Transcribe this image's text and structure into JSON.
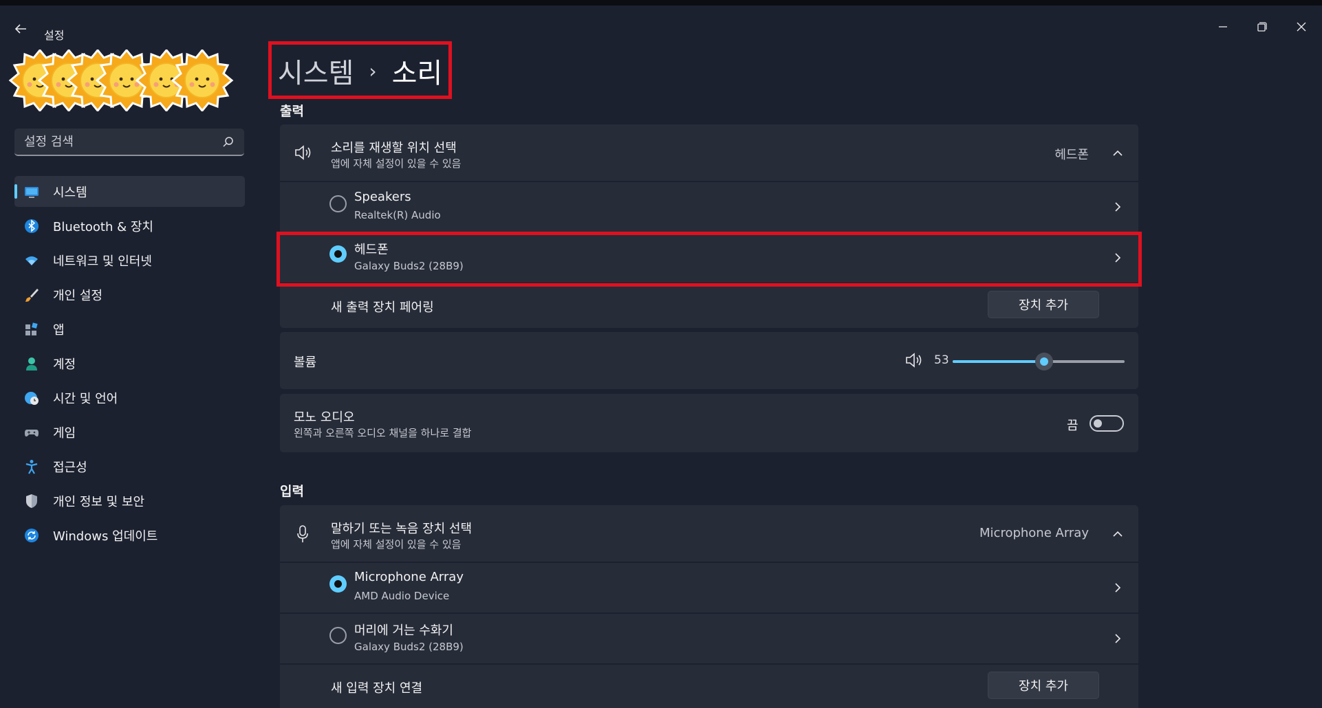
{
  "window": {
    "title": "설정"
  },
  "search": {
    "placeholder": "설정 검색"
  },
  "sidebar": {
    "items": [
      {
        "label": "시스템",
        "icon": "monitor-icon"
      },
      {
        "label": "Bluetooth & 장치",
        "icon": "bluetooth-icon"
      },
      {
        "label": "네트워크 및 인터넷",
        "icon": "wifi-icon"
      },
      {
        "label": "개인 설정",
        "icon": "brush-icon"
      },
      {
        "label": "앱",
        "icon": "apps-icon"
      },
      {
        "label": "계정",
        "icon": "person-icon"
      },
      {
        "label": "시간 및 언어",
        "icon": "globe-clock-icon"
      },
      {
        "label": "게임",
        "icon": "gamepad-icon"
      },
      {
        "label": "접근성",
        "icon": "accessibility-icon"
      },
      {
        "label": "개인 정보 및 보안",
        "icon": "shield-icon"
      },
      {
        "label": "Windows 업데이트",
        "icon": "update-icon"
      }
    ],
    "active_index": 0
  },
  "breadcrumb": {
    "parent": "시스템",
    "separator": "›",
    "current": "소리"
  },
  "output": {
    "heading": "출력",
    "select": {
      "title": "소리를 재생할 위치 선택",
      "subtitle": "앱에 자체 설정이 있을 수 있음",
      "value": "헤드폰"
    },
    "devices": [
      {
        "name": "Speakers",
        "detail": "Realtek(R) Audio",
        "selected": false
      },
      {
        "name": "헤드폰",
        "detail": "Galaxy Buds2 (28B9)",
        "selected": true
      }
    ],
    "pair": {
      "label": "새 출력 장치 페어링",
      "button": "장치 추가"
    }
  },
  "volume": {
    "label": "볼륨",
    "value": "53",
    "level": 0.53
  },
  "mono": {
    "title": "모노 오디오",
    "subtitle": "왼쪽과 오른쪽 오디오 채널을 하나로 결합",
    "state": "끔"
  },
  "input": {
    "heading": "입력",
    "select": {
      "title": "말하기 또는 녹음 장치 선택",
      "subtitle": "앱에 자체 설정이 있을 수 있음",
      "value": "Microphone Array"
    },
    "devices": [
      {
        "name": "Microphone Array",
        "detail": "AMD Audio Device",
        "selected": true
      },
      {
        "name": "머리에 거는 수화기",
        "detail": "Galaxy Buds2 (28B9)",
        "selected": false
      }
    ],
    "connect": {
      "label": "새 입력 장치 연결",
      "button": "장치 추가"
    }
  },
  "colors": {
    "accent": "#60cdff",
    "highlight": "#e0101f",
    "background": "#1c2130",
    "card": "#272c39"
  }
}
